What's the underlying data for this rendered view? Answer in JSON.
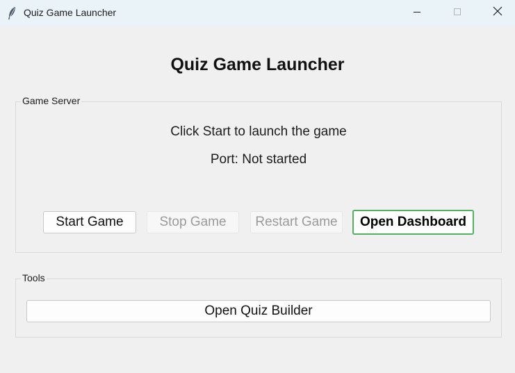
{
  "window": {
    "title": "Quiz Game Launcher",
    "app_icon": "feather-icon",
    "controls": {
      "minimize_icon": "minimize-icon",
      "maximize_icon": "maximize-icon",
      "close_icon": "close-icon"
    }
  },
  "heading": "Quiz Game Launcher",
  "game_server": {
    "label": "Game Server",
    "status": "Click Start to launch the game",
    "port": "Port: Not started",
    "buttons": {
      "start": "Start Game",
      "stop": "Stop Game",
      "restart": "Restart Game",
      "dashboard": "Open Dashboard"
    },
    "stop_enabled": false,
    "restart_enabled": false
  },
  "tools": {
    "label": "Tools",
    "quiz_builder": "Open Quiz Builder"
  },
  "colors": {
    "background": "#f0f0f0",
    "titlebar": "#eaf3f8",
    "focus_border": "#53b15f",
    "disabled_text": "#9a9a9a"
  }
}
